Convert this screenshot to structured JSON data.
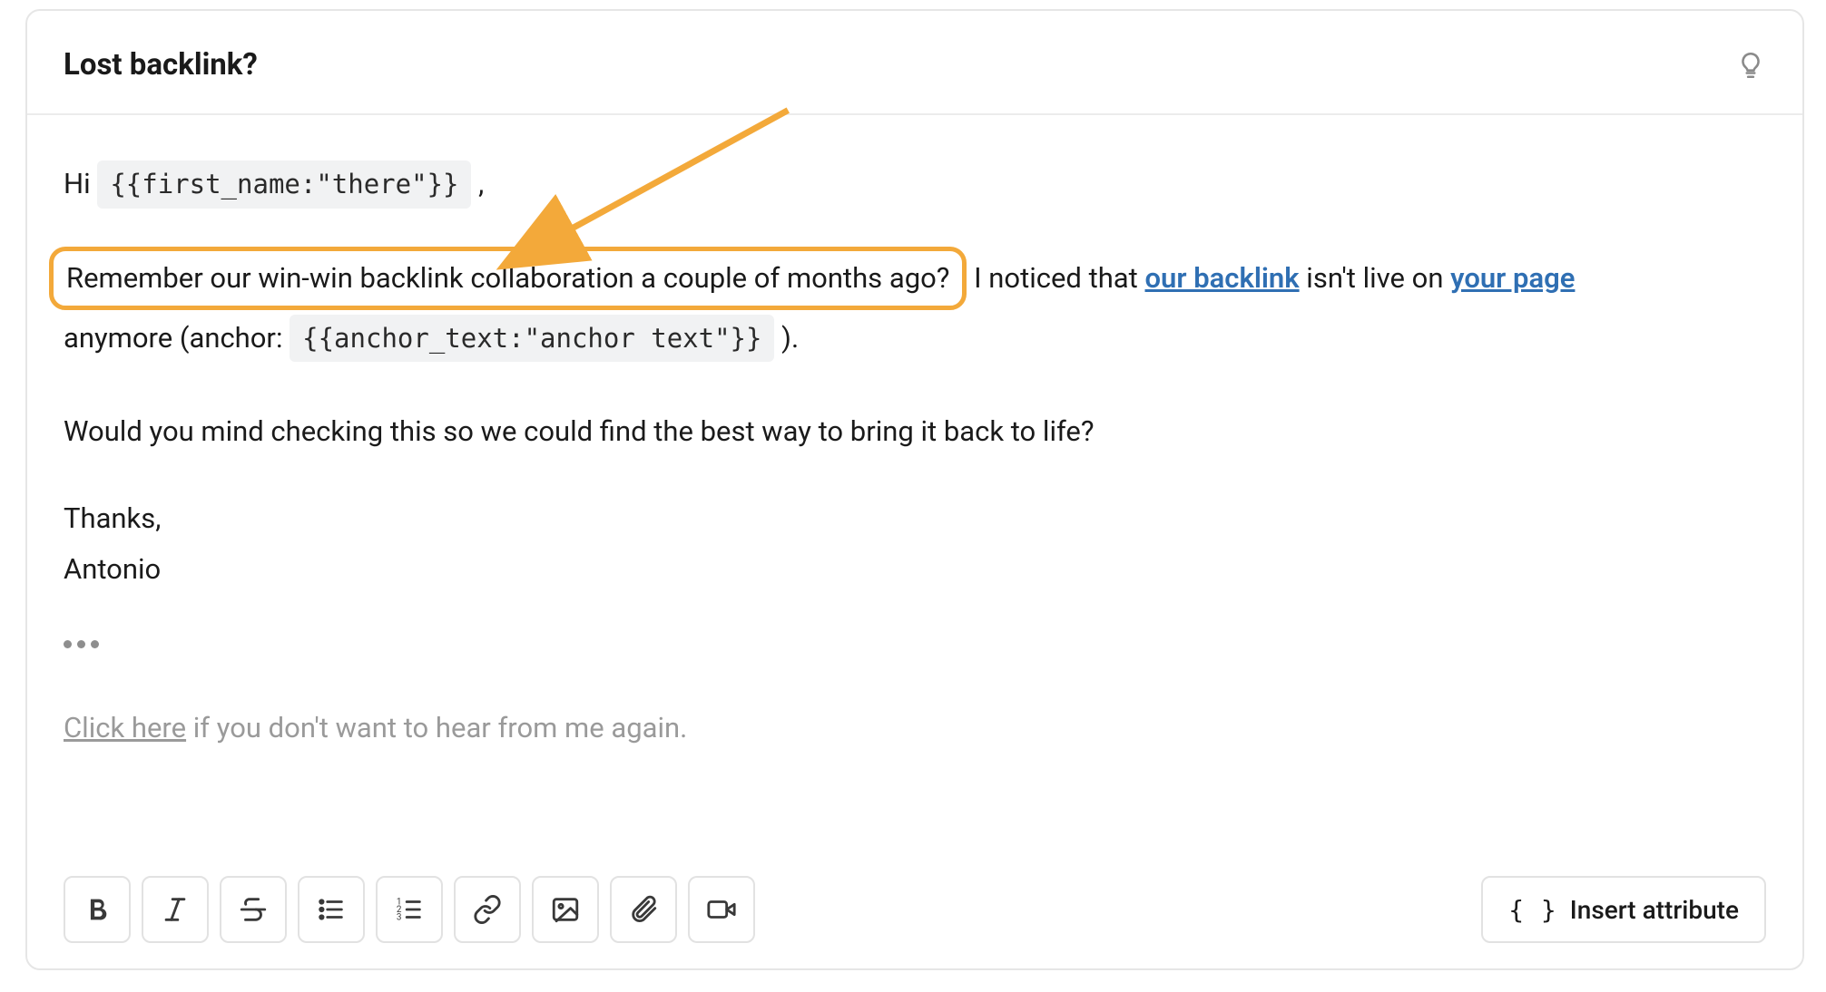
{
  "header": {
    "subject": "Lost backlink?"
  },
  "body": {
    "greeting_prefix": "Hi ",
    "greeting_var": "{{first_name:\"there\"}}",
    "greeting_suffix": " ,",
    "p1_highlight": "Remember our win-win backlink collaboration a couple of months ago?",
    "p1_after_highlight": " I noticed that ",
    "p1_link1": "our backlink",
    "p1_mid": " isn't live on ",
    "p1_link2": "your page",
    "p1_line2_pre": "anymore (anchor:  ",
    "p1_anchor_var": "{{anchor_text:\"anchor text\"}}",
    "p1_line2_post": "  ).",
    "p2": "Would you mind checking this so we could find the best way to bring it back to life?",
    "thanks": "Thanks,",
    "sign_name": "Antonio",
    "unsub_link": "Click here",
    "unsub_rest": " if you don't want to hear from me again."
  },
  "toolbar": {
    "insert_attribute": "Insert attribute"
  },
  "colors": {
    "highlight": "#f3a93a",
    "link": "#2f6fb3"
  }
}
